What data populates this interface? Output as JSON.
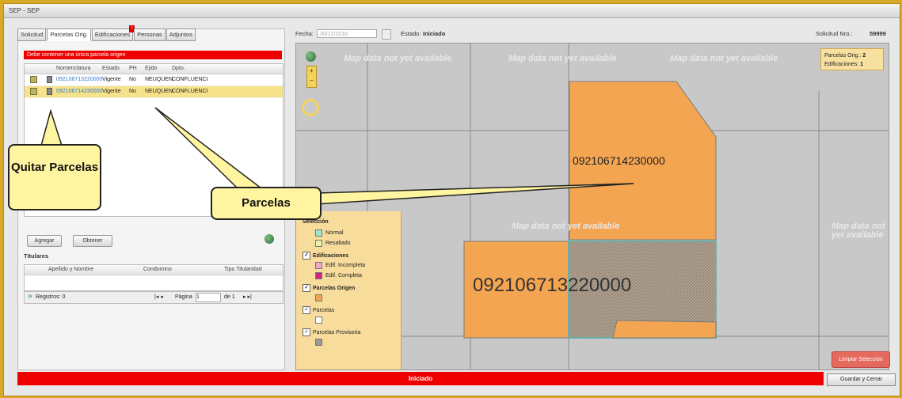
{
  "window": {
    "title": "SEP - SEP"
  },
  "tabs": [
    {
      "label": "Solicitud"
    },
    {
      "label": "Parcelas Orig."
    },
    {
      "label": "Edificaciones"
    },
    {
      "label": "Personas"
    },
    {
      "label": "Adjuntos"
    }
  ],
  "header": {
    "fecha_label": "Fecha:",
    "fecha_value": "30/12/2016",
    "estado_label": "Estado:",
    "estado_value": "Iniciado",
    "solicitud_label": "Solicitud Nro.:",
    "solicitud_value": "59999"
  },
  "parcelas": {
    "error": "Debe contener una única parcela origen",
    "columns": [
      "Nomenclatura",
      "Estado",
      "PH",
      "Ejido",
      "Dpto."
    ],
    "rows": [
      {
        "nomenclatura": "092106713220000",
        "estado": "Vigente",
        "ph": "No",
        "ejido": "NEUQUEN",
        "dpto": "CONFLUENCI"
      },
      {
        "nomenclatura": "092106714230000",
        "estado": "Vigente",
        "ph": "No",
        "ejido": "NEUQUEN",
        "dpto": "CONFLUENCI"
      }
    ],
    "agregar_label": "Agregar",
    "obtener_label": "Obtener"
  },
  "titulares": {
    "title": "Titulares",
    "columns": [
      "Apellido y Nombre",
      "Condomino",
      "Tipo Titularidad"
    ],
    "registros": "Registros: 0",
    "pagina_label": "Página",
    "pagina_value": "1",
    "de_label": "de 1"
  },
  "map": {
    "watermark": "Map data not yet available",
    "parcela_big": "092106714230000",
    "parcela_small": "092106713220000",
    "counts": {
      "parcelas_label": "Parcelas Orig.:",
      "parcelas_value": "2",
      "edif_label": "Edificaciones:",
      "edif_value": "1"
    },
    "legend": {
      "seleccion": "Selección",
      "normal": "Normal",
      "resaltado": "Resaltado",
      "edificaciones": "Edificaciones",
      "edif_incompleta": "Edif. Incompleta",
      "edif_completa": "Edif. Completa",
      "parcelas_origen": "Parcelas Origen",
      "parcelas": "Parcelas",
      "parcelas_provisoria": "Parcelas Provisoria"
    },
    "limpiar_label": "Limpiar Selección",
    "colors": {
      "parcel": "#f4a552",
      "normal": "#98ebd0",
      "resaltado": "#e6f2a8",
      "edif_incompleta": "#f0a6c8",
      "edif_completa": "#d02580",
      "provisoria": "#999999"
    }
  },
  "status": {
    "text": "Iniciado",
    "save_label": "Guardar y Cerrar"
  },
  "callouts": {
    "quitar": "Quitar Parcelas",
    "parcelas": "Parcelas"
  }
}
